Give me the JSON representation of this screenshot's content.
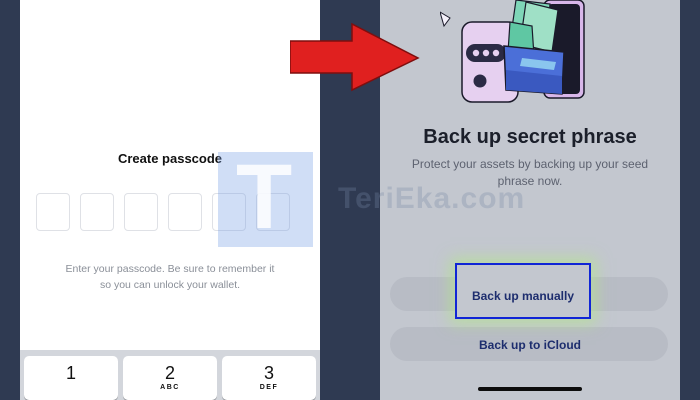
{
  "left_screen": {
    "title": "Create passcode",
    "hint_line1": "Enter your passcode. Be sure to remember it",
    "hint_line2": "so you can unlock your wallet.",
    "passcode_length": 6,
    "keypad": [
      {
        "number": "1",
        "letters": ""
      },
      {
        "number": "2",
        "letters": "ABC"
      },
      {
        "number": "3",
        "letters": "DEF"
      }
    ]
  },
  "right_screen": {
    "title": "Back up secret phrase",
    "subtitle_line1": "Protect your assets by backing up your seed",
    "subtitle_line2": "phrase now.",
    "manual_button_label": "Back up manually",
    "icloud_button_label": "Back up to iCloud"
  },
  "watermark": {
    "logo_letter": "T",
    "text": "TeriEka.com"
  },
  "colors": {
    "arrow": "#e0201f",
    "highlight_border": "#1025d6",
    "background": "#2f3a52"
  }
}
